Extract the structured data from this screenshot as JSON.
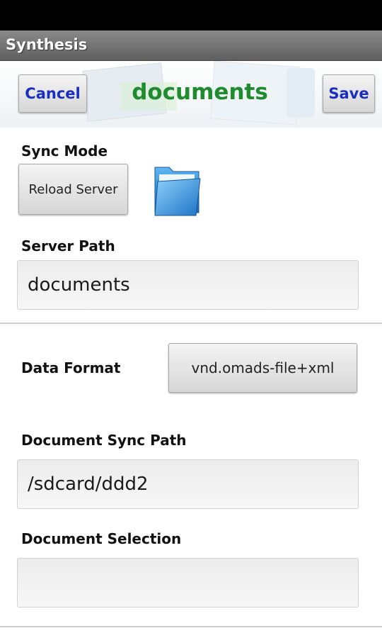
{
  "app": {
    "title": "Synthesis"
  },
  "header": {
    "cancel_label": "Cancel",
    "heading": "documents",
    "save_label": "Save"
  },
  "sync_mode": {
    "label": "Sync Mode",
    "button_label": "Reload Server",
    "icon": "folder-icon"
  },
  "server_path": {
    "label": "Server Path",
    "value": "documents"
  },
  "data_format": {
    "label": "Data Format",
    "value": "vnd.omads-file+xml"
  },
  "document_sync_path": {
    "label": "Document Sync Path",
    "value": "/sdcard/ddd2"
  },
  "document_selection": {
    "label": "Document Selection",
    "value": ""
  },
  "colors": {
    "heading": "#1f8a2e",
    "header_buttons": "#1a2fbf",
    "title_bar": "#6e6e6e"
  }
}
